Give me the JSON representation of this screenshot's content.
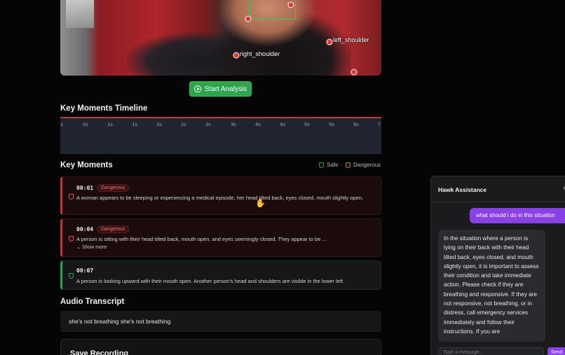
{
  "video": {
    "keypoint_labels": {
      "left_shoulder": "left_shoulder",
      "right_shoulder": "right_shoulder"
    }
  },
  "actions": {
    "start_analysis": "Start Analysis"
  },
  "timeline": {
    "title": "Key Moments Timeline",
    "ticks": [
      "s",
      "0s",
      "1s",
      "1s",
      "2s",
      "2s",
      "3s",
      "3s",
      "4s",
      "4s",
      "5s",
      "5s",
      "6s",
      "7"
    ]
  },
  "key_moments": {
    "title": "Key Moments",
    "legend": {
      "safe": "Safe",
      "dangerous": "Dangerous"
    },
    "items": [
      {
        "time": "00:01",
        "status": "Dangerous",
        "description": "A woman appears to be sleeping or experiencing a medical episode, her head tilted back, eyes closed, mouth slightly open."
      },
      {
        "time": "00:04",
        "status": "Dangerous",
        "description": "A person is sitting with their head tilted back, mouth open, and eyes seemingly closed.  They appear to be ...",
        "more": "Show more"
      },
      {
        "time": "00:07",
        "status": "Safe",
        "description": "A person is looking upward with their mouth open.  Another person's head and shoulders are visible in the lower left."
      }
    ]
  },
  "audio": {
    "title": "Audio Transcript",
    "text": "she's not breathing she's not breathing"
  },
  "save": {
    "title": "Save Recording"
  },
  "chat": {
    "title": "Hawk Assistance",
    "close": "×",
    "user_message": "what should i do in this situation",
    "assistant_message": "In the situation where a person is lying on their back with their head tilted back, eyes closed, and mouth slightly open, it is important to assess their condition and take immediate action. Please check if they are breathing and responsive. If they are not responsive, not breathing, or in distress, call emergency services immediately and follow their instructions. If you are",
    "input_placeholder": "Type a message...",
    "send": "Send"
  },
  "colors": {
    "safe": "#2e9e54",
    "dangerous": "#b33a3f",
    "accent": "#8b3fe6",
    "start": "#2ea44f"
  }
}
